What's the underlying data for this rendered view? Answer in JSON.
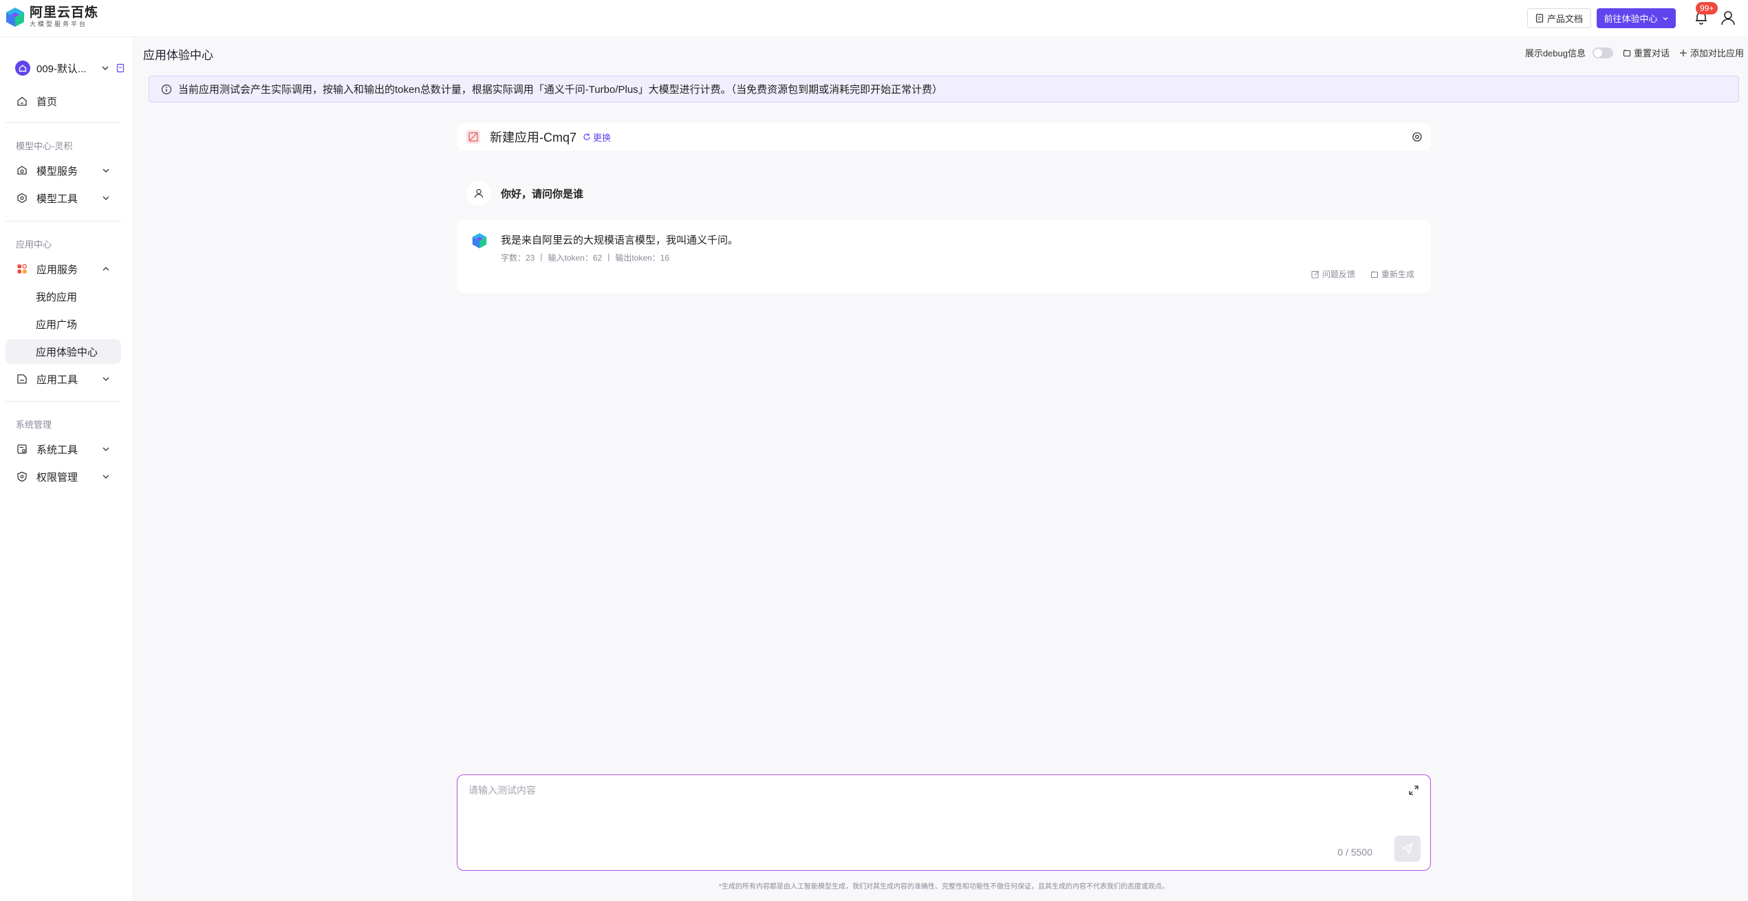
{
  "header": {
    "logo_title": "阿里云百炼",
    "logo_subtitle": "大模型服务平台",
    "doc_button": "产品文档",
    "primary_button": "前往体验中心",
    "notification_badge": "99+"
  },
  "sidebar": {
    "workspace": "009-默认...",
    "home": "首页",
    "section_model": "模型中心-灵积",
    "model_service": "模型服务",
    "model_tools": "模型工具",
    "section_app": "应用中心",
    "app_service": "应用服务",
    "my_apps": "我的应用",
    "app_square": "应用广场",
    "app_experience": "应用体验中心",
    "app_tools": "应用工具",
    "section_system": "系统管理",
    "system_tools": "系统工具",
    "permissions": "权限管理"
  },
  "main": {
    "page_title": "应用体验中心",
    "debug_label": "展示debug信息",
    "reset_label": "重置对话",
    "add_compare_label": "添加对比应用",
    "notice": "当前应用测试会产生实际调用，按输入和输出的token总数计量，根据实际调用「通义千问-Turbo/Plus」大模型进行计费。（当免费资源包到期或消耗完即开始正常计费）",
    "app_name": "新建应用-Cmq7",
    "change_label": "更换"
  },
  "chat": {
    "user_message": "你好，请问你是谁",
    "bot_message": "我是来自阿里云的大规模语言模型，我叫通义千问。",
    "stats": {
      "chars": "字数：23",
      "input_tokens": "输入token：62",
      "output_tokens": "输出token：16"
    },
    "feedback_label": "问题反馈",
    "regenerate_label": "重新生成"
  },
  "input": {
    "placeholder": "请输入测试内容",
    "counter": "0 / 5500",
    "disclaimer": "*生成的所有内容都是由人工智能模型生成，我们对其生成内容的准确性、完整性和功能性不做任何保证，且其生成的内容不代表我们的态度或观点。"
  },
  "colors": {
    "accent": "#6144ee",
    "input_border": "#b94ee0",
    "badge": "#f0483e"
  }
}
